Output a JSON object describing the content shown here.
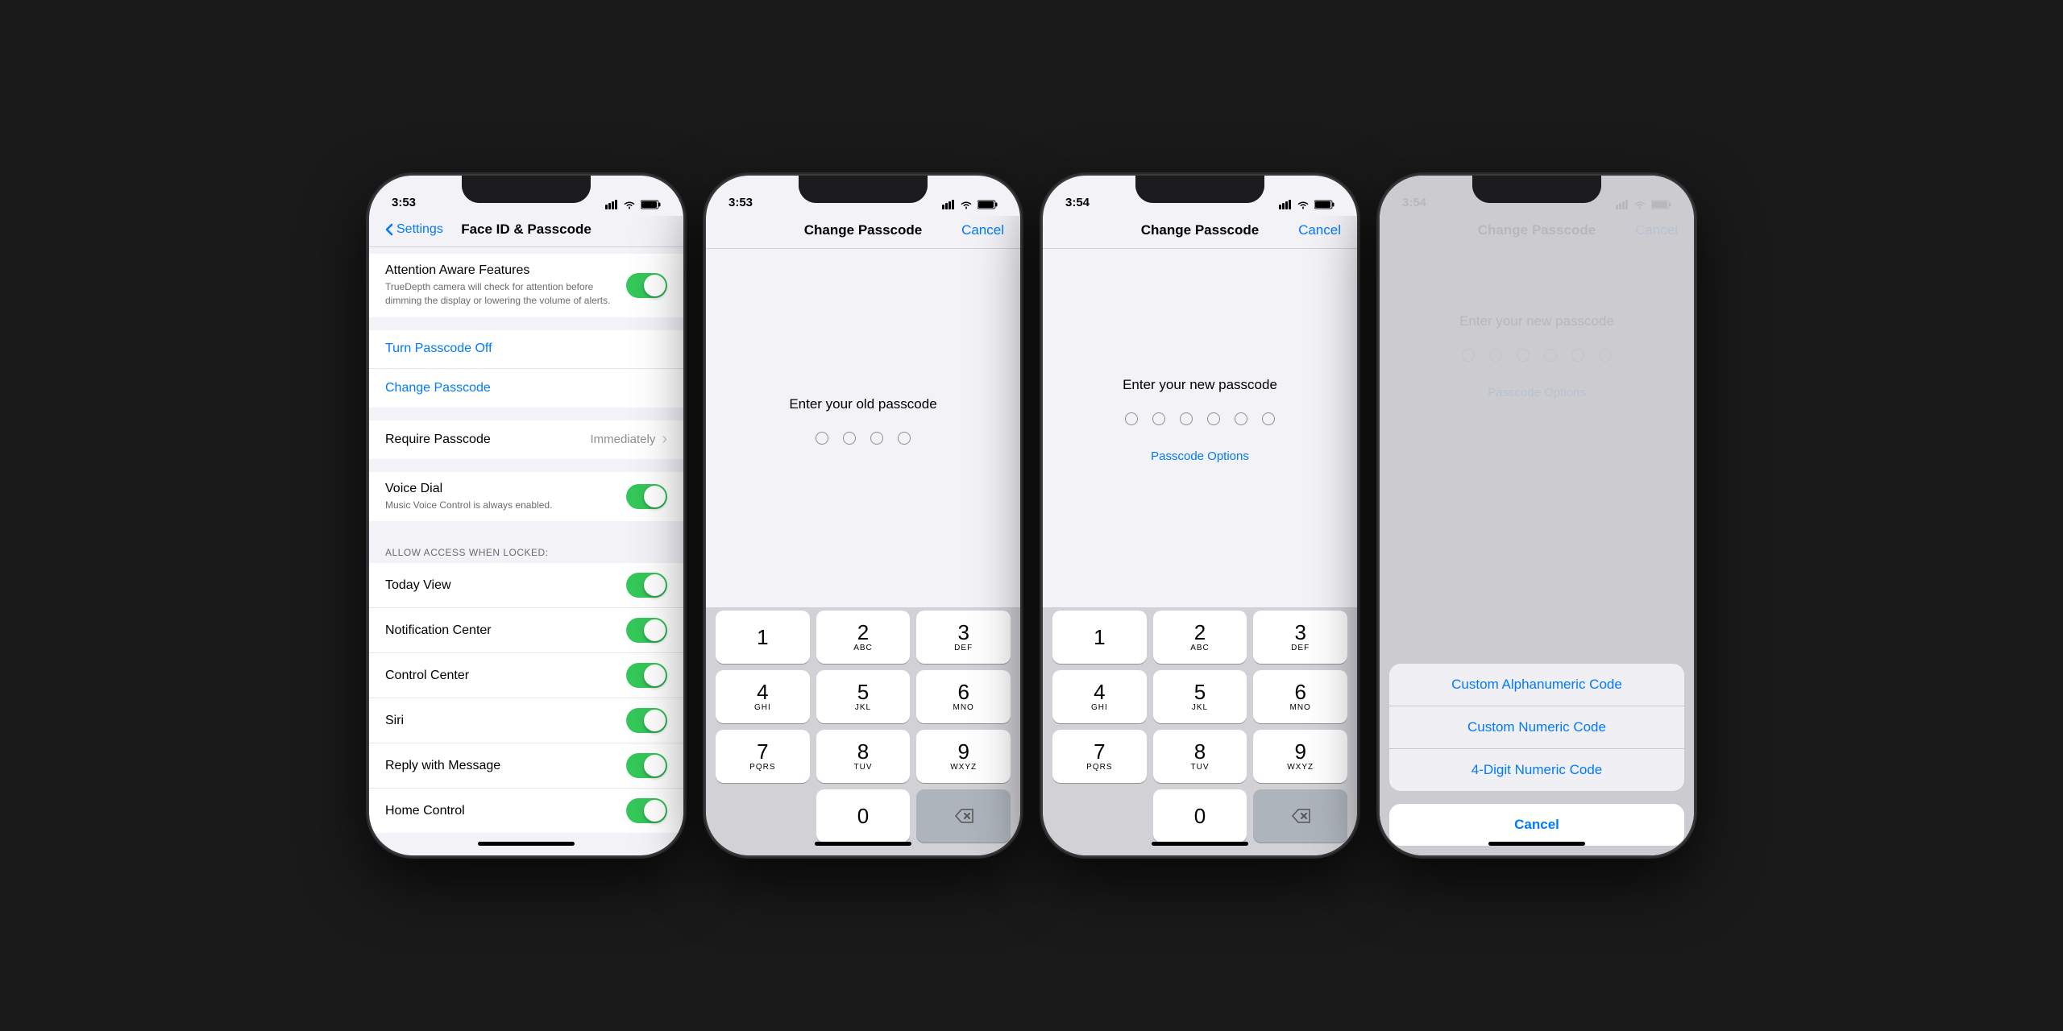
{
  "phones": [
    {
      "id": "phone1",
      "time": "3:53",
      "screen": "settings",
      "nav": {
        "back_label": "Settings",
        "title": "Face ID & Passcode"
      },
      "sections": [
        {
          "rows": [
            {
              "type": "toggle-with-sub",
              "label": "Attention Aware Features",
              "sublabel": "TrueDepth camera will check for attention before dimming the display or lowering the volume of alerts.",
              "toggle": true
            }
          ]
        },
        {
          "rows": [
            {
              "type": "link",
              "label": "Turn Passcode Off"
            },
            {
              "type": "link",
              "label": "Change Passcode"
            }
          ]
        },
        {
          "rows": [
            {
              "type": "detail",
              "label": "Require Passcode",
              "value": "Immediately"
            }
          ]
        },
        {
          "rows": [
            {
              "type": "toggle-with-sub",
              "label": "Voice Dial",
              "sublabel": "Music Voice Control is always enabled.",
              "toggle": true
            }
          ]
        },
        {
          "header": "ALLOW ACCESS WHEN LOCKED:",
          "rows": [
            {
              "type": "toggle",
              "label": "Today View",
              "toggle": true
            },
            {
              "type": "toggle",
              "label": "Notification Center",
              "toggle": true
            },
            {
              "type": "toggle",
              "label": "Control Center",
              "toggle": true
            },
            {
              "type": "toggle",
              "label": "Siri",
              "toggle": true
            },
            {
              "type": "toggle",
              "label": "Reply with Message",
              "toggle": true
            },
            {
              "type": "toggle",
              "label": "Home Control",
              "toggle": true
            }
          ]
        }
      ]
    },
    {
      "id": "phone2",
      "time": "3:53",
      "screen": "passcode-old",
      "nav": {
        "title": "Change Passcode",
        "cancel_label": "Cancel"
      },
      "prompt": "Enter your old passcode",
      "dots": 4,
      "show_options": false,
      "keyboard": true
    },
    {
      "id": "phone3",
      "time": "3:54",
      "screen": "passcode-new",
      "nav": {
        "title": "Change Passcode",
        "cancel_label": "Cancel"
      },
      "prompt": "Enter your new passcode",
      "dots": 6,
      "show_options": true,
      "options_label": "Passcode Options",
      "keyboard": true
    },
    {
      "id": "phone4",
      "time": "3:54",
      "screen": "passcode-options",
      "nav": {
        "title": "Change Passcode",
        "cancel_label": "Cancel"
      },
      "prompt": "Enter your new passcode",
      "dots": 6,
      "show_options": true,
      "options_label": "Passcode Options",
      "keyboard": true,
      "sheet": {
        "items": [
          "Custom Alphanumeric Code",
          "Custom Numeric Code",
          "4-Digit Numeric Code"
        ],
        "cancel": "Cancel"
      }
    }
  ],
  "keyboard_rows": [
    [
      {
        "num": "1",
        "letters": ""
      },
      {
        "num": "2",
        "letters": "ABC"
      },
      {
        "num": "3",
        "letters": "DEF"
      }
    ],
    [
      {
        "num": "4",
        "letters": "GHI"
      },
      {
        "num": "5",
        "letters": "JKL"
      },
      {
        "num": "6",
        "letters": "MNO"
      }
    ],
    [
      {
        "num": "7",
        "letters": "PQRS"
      },
      {
        "num": "8",
        "letters": "TUV"
      },
      {
        "num": "9",
        "letters": "WXYZ"
      }
    ]
  ]
}
